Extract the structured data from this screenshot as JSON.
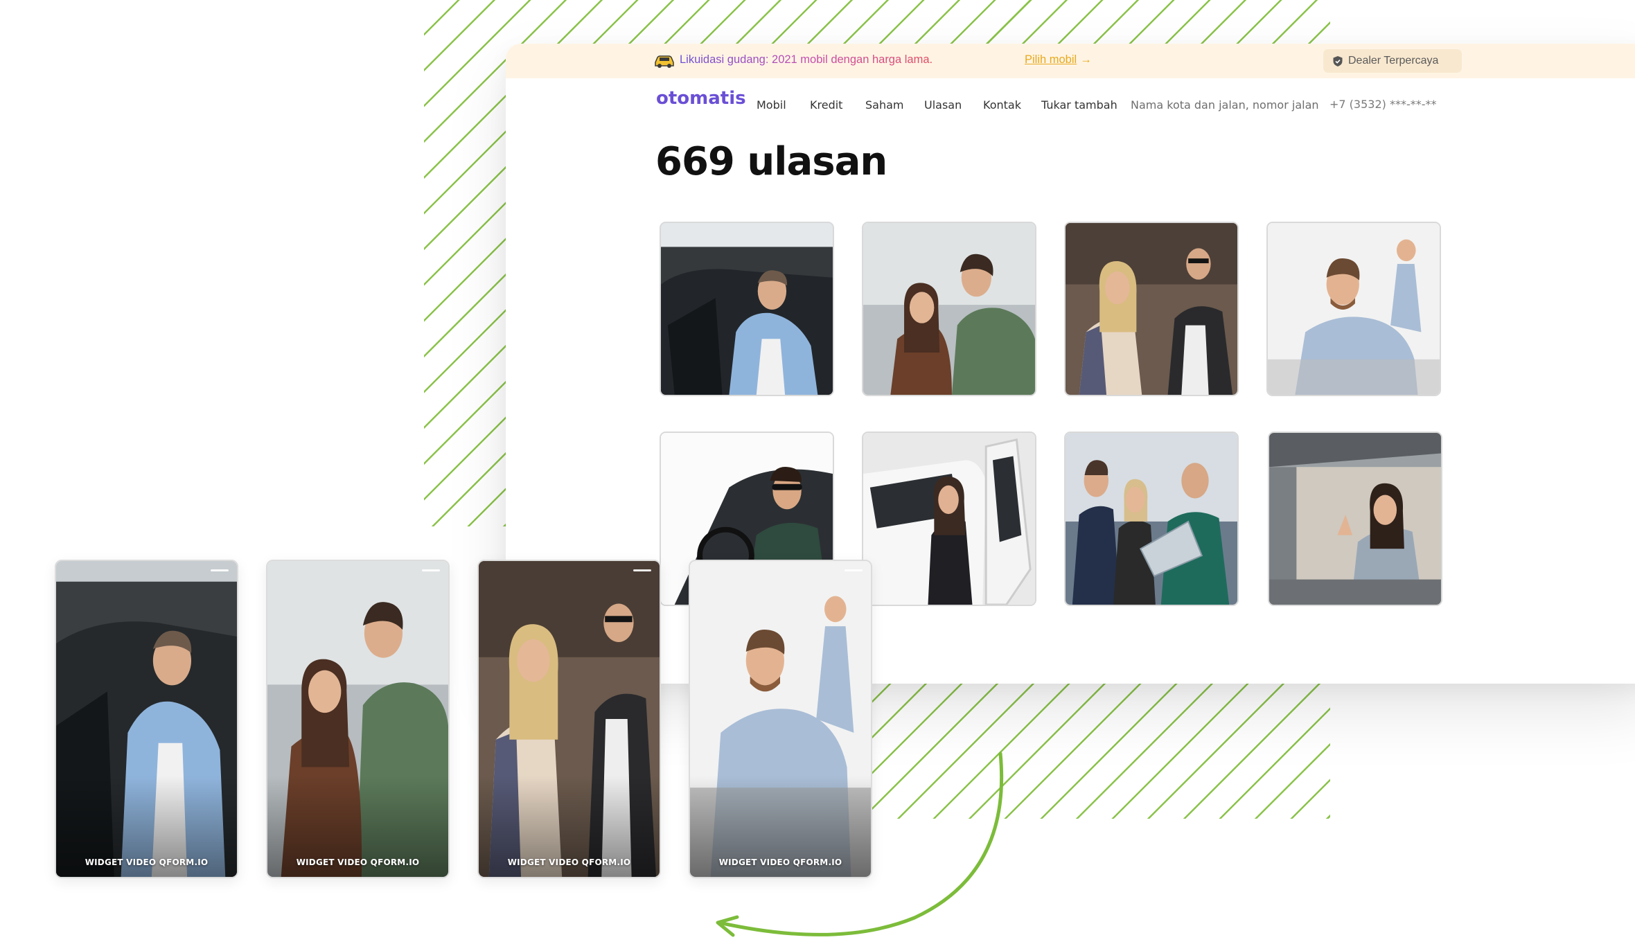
{
  "promo": {
    "text": "Likuidasi gudang: 2021 mobil dengan harga lama.",
    "link": "Pilih mobil",
    "link_arrow": "→",
    "badge": "Dealer Terpercaya"
  },
  "nav": {
    "logo": "otomatis",
    "items": [
      "Mobil",
      "Kredit",
      "Saham",
      "Ulasan",
      "Kontak",
      "Tukar tambah"
    ],
    "address": "Nama kota dan jalan, nomor jalan",
    "phone": "+7 (3532) ***-**-**"
  },
  "page": {
    "title": "669 ulasan"
  },
  "reviews": [
    {
      "scene": "man-leaning-on-car-door"
    },
    {
      "scene": "couple-celebrating"
    },
    {
      "scene": "couple-with-salesman"
    },
    {
      "scene": "man-holding-car-keys"
    },
    {
      "scene": "man-in-car-driver-seat"
    },
    {
      "scene": "woman-stepping-out-of-car"
    },
    {
      "scene": "family-reading-brochure"
    },
    {
      "scene": "woman-thumbs-up-in-car"
    }
  ],
  "video_widgets": [
    {
      "caption": "WIDGET VIDEO QFORM.IO"
    },
    {
      "caption": "WIDGET VIDEO QFORM.IO"
    },
    {
      "caption": "WIDGET VIDEO QFORM.IO"
    },
    {
      "caption": "WIDGET VIDEO QFORM.IO"
    }
  ],
  "colors": {
    "brand": "#6a4fd6",
    "promo_bg": "#fff4e4",
    "link": "#e8a91c",
    "stripe": "#8bc34a",
    "arrow": "#7cbc3a"
  }
}
